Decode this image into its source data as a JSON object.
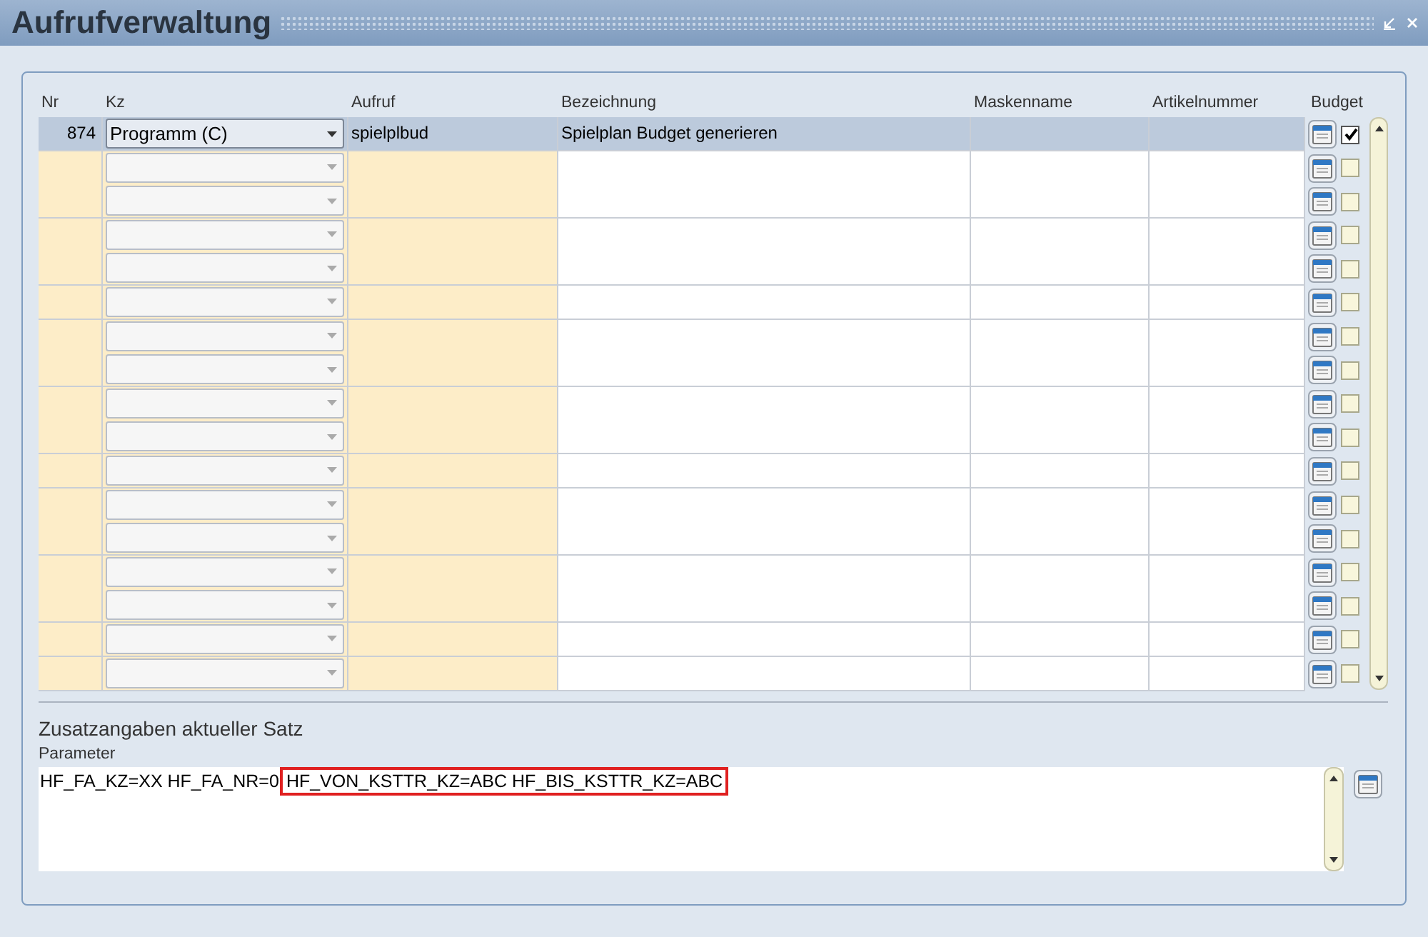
{
  "window": {
    "title": "Aufrufverwaltung"
  },
  "table": {
    "columns": [
      "Nr",
      "Kz",
      "Aufruf",
      "Bezeichnung",
      "Maskenname",
      "Artikelnummer",
      "Budget"
    ],
    "rows": [
      {
        "nr": "874",
        "kz": "Programm (C)",
        "aufruf": "spielplbud",
        "bezeichnung": "Spielplan Budget generieren",
        "selected": true,
        "checked": true
      },
      {
        "selected": false,
        "checked": false
      },
      {
        "selected": false,
        "checked": false
      },
      {
        "selected": false,
        "checked": false
      },
      {
        "selected": false,
        "checked": false
      },
      {
        "selected": false,
        "checked": false
      },
      {
        "selected": false,
        "checked": false
      },
      {
        "selected": false,
        "checked": false
      },
      {
        "selected": false,
        "checked": false
      },
      {
        "selected": false,
        "checked": false
      },
      {
        "selected": false,
        "checked": false
      },
      {
        "selected": false,
        "checked": false
      },
      {
        "selected": false,
        "checked": false
      },
      {
        "selected": false,
        "checked": false
      },
      {
        "selected": false,
        "checked": false
      },
      {
        "selected": false,
        "checked": false
      },
      {
        "selected": false,
        "checked": false
      }
    ]
  },
  "details": {
    "title": "Zusatzangaben aktueller Satz",
    "parameter_label": "Parameter",
    "parameter_parts": [
      {
        "text": "HF_FA_KZ=XX HF_FA_NR=0",
        "highlighted": false
      },
      {
        "text": "HF_VON_KSTTR_KZ=ABC HF_BIS_KSTTR_KZ=ABC",
        "highlighted": true
      }
    ]
  }
}
